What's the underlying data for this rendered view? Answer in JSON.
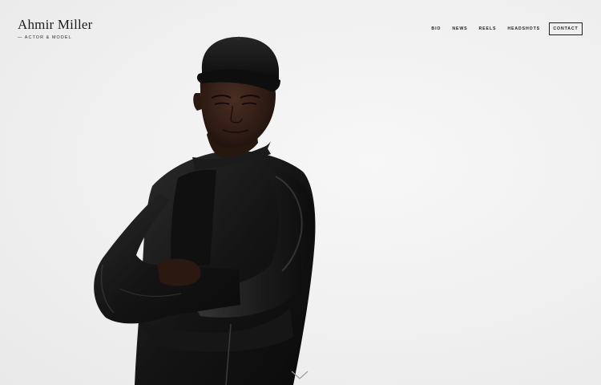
{
  "site": {
    "name": "Ahmir Miller",
    "tagline": "— ACTOR & MODEL"
  },
  "nav": {
    "items": [
      {
        "label": "BIO"
      },
      {
        "label": "NEWS"
      },
      {
        "label": "REELS"
      },
      {
        "label": "HEADSHOTS"
      }
    ],
    "contact_label": "CONTACT"
  },
  "hero": {
    "scroll_icon": "chevron-down-icon",
    "background": "#f1f1f1"
  }
}
